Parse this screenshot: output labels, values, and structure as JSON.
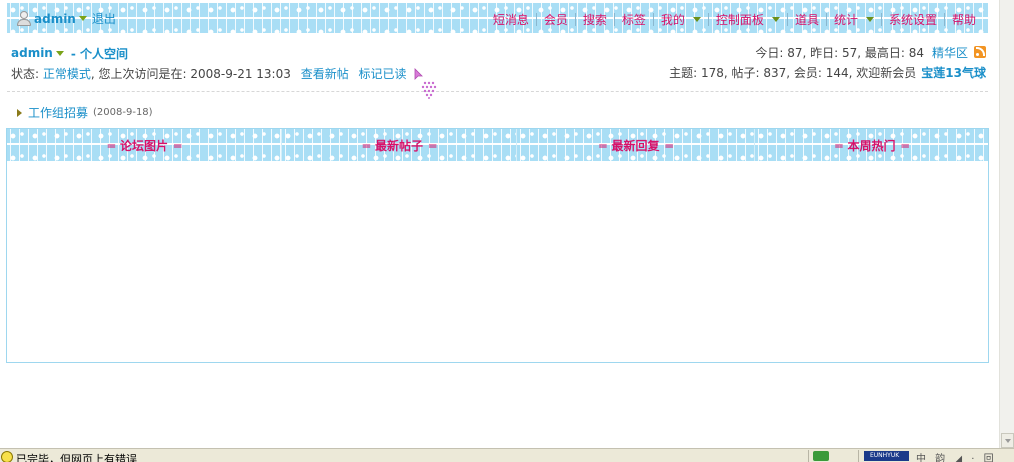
{
  "topbar": {
    "username": "admin",
    "logout": "退出",
    "menu": [
      {
        "label": "短消息",
        "dropdown": false
      },
      {
        "label": "会员",
        "dropdown": false
      },
      {
        "label": "搜索",
        "dropdown": false
      },
      {
        "label": "标签",
        "dropdown": false
      },
      {
        "label": "我的",
        "dropdown": true
      },
      {
        "label": "控制面板",
        "dropdown": true
      },
      {
        "label": "道具",
        "dropdown": false
      },
      {
        "label": "统计",
        "dropdown": true
      },
      {
        "label": "系统设置",
        "dropdown": false
      },
      {
        "label": "帮助",
        "dropdown": false
      }
    ]
  },
  "userinfo": {
    "name": "admin",
    "space": "- 个人空间",
    "status_prefix": "状态: ",
    "mode": "正常模式",
    "last_visit": ", 您上次访问是在: 2008-9-21 13:03",
    "view_new": "查看新帖",
    "mark_read": "标记已读"
  },
  "stats": {
    "counts": "今日: 87, 昨日: 57, 最高日: 84",
    "digest": "精华区",
    "summary": "主题: 178, 帖子: 837, 会员: 144, 欢迎新会员",
    "new_member": "宝莲13气球"
  },
  "announcement": {
    "title": "工作组招募",
    "date": "(2008-9-18)"
  },
  "panel": {
    "tabs": [
      {
        "label": "论坛图片"
      },
      {
        "label": "最新帖子"
      },
      {
        "label": "最新回复"
      },
      {
        "label": "本周热门"
      }
    ]
  },
  "statusbar": {
    "text": "已完毕，但网页上有错误",
    "tray_label": "EUNHYUK",
    "tray_glyphs": "中 韵 ◢ · 回 ♥"
  },
  "colors": {
    "accent_pink": "#d6126a",
    "link_blue": "#1a8fc9",
    "lace_blue": "#a9def5"
  }
}
